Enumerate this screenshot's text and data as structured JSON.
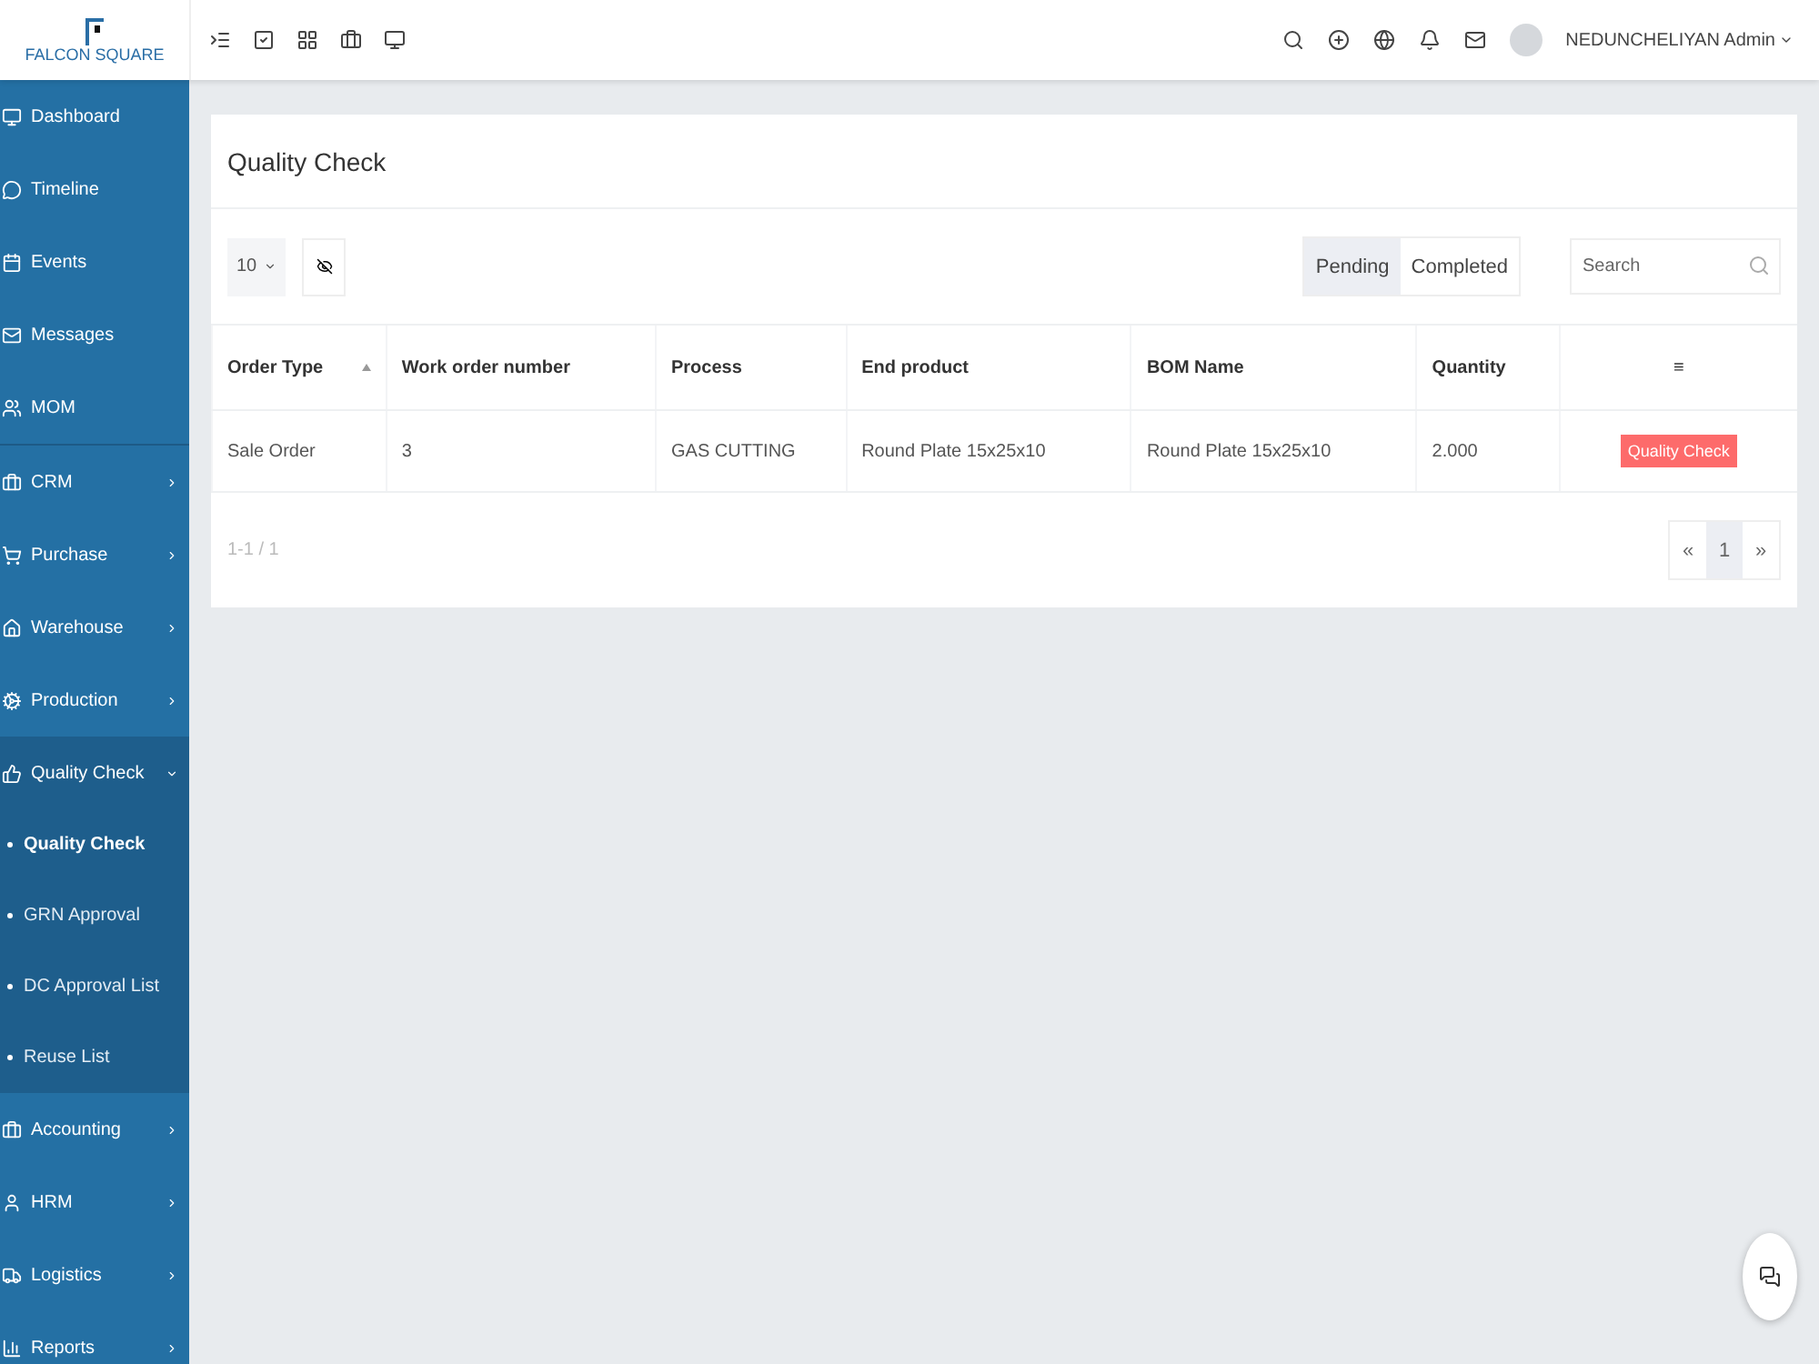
{
  "brand": {
    "name": "FALCON SQUARE"
  },
  "user": {
    "name": "NEDUNCHELIYAN Admin"
  },
  "sidebar": {
    "items": [
      {
        "label": "Dashboard"
      },
      {
        "label": "Timeline"
      },
      {
        "label": "Events"
      },
      {
        "label": "Messages"
      },
      {
        "label": "MOM"
      },
      {
        "label": "CRM",
        "expanded": false
      },
      {
        "label": "Purchase",
        "expanded": false
      },
      {
        "label": "Warehouse",
        "expanded": false
      },
      {
        "label": "Production",
        "expanded": false
      },
      {
        "label": "Quality Check",
        "expanded": true,
        "children": [
          {
            "label": "Quality Check",
            "selected": true
          },
          {
            "label": "GRN Approval",
            "selected": false
          },
          {
            "label": "DC Approval List",
            "selected": false
          },
          {
            "label": "Reuse List",
            "selected": false
          }
        ]
      },
      {
        "label": "Accounting",
        "expanded": false
      },
      {
        "label": "HRM",
        "expanded": false
      },
      {
        "label": "Logistics",
        "expanded": false
      },
      {
        "label": "Reports",
        "expanded": false
      }
    ]
  },
  "page": {
    "title": "Quality Check"
  },
  "toolbar": {
    "page_size": "10",
    "filters": [
      {
        "label": "Pending",
        "selected": true
      },
      {
        "label": "Completed",
        "selected": false
      }
    ],
    "search": {
      "placeholder": "Search"
    }
  },
  "table": {
    "columns": [
      {
        "label": "Order Type",
        "sorted": true
      },
      {
        "label": "Work order number",
        "sorted": false
      },
      {
        "label": "Process",
        "sorted": false
      },
      {
        "label": "End product",
        "sorted": false
      },
      {
        "label": "BOM Name",
        "sorted": false
      },
      {
        "label": "Quantity",
        "sorted": false
      },
      {
        "label": "≡",
        "sorted": false
      }
    ],
    "rows": [
      {
        "cells": [
          "Sale Order",
          "3",
          "GAS CUTTING",
          "Round Plate 15x25x10",
          "Round Plate 15x25x10",
          "2.000"
        ],
        "action": "Quality Check"
      }
    ]
  },
  "footer": {
    "count": "1-1 / 1",
    "pagination": [
      {
        "label": "«",
        "selected": false
      },
      {
        "label": "1",
        "selected": true
      },
      {
        "label": "»",
        "selected": false
      }
    ]
  }
}
